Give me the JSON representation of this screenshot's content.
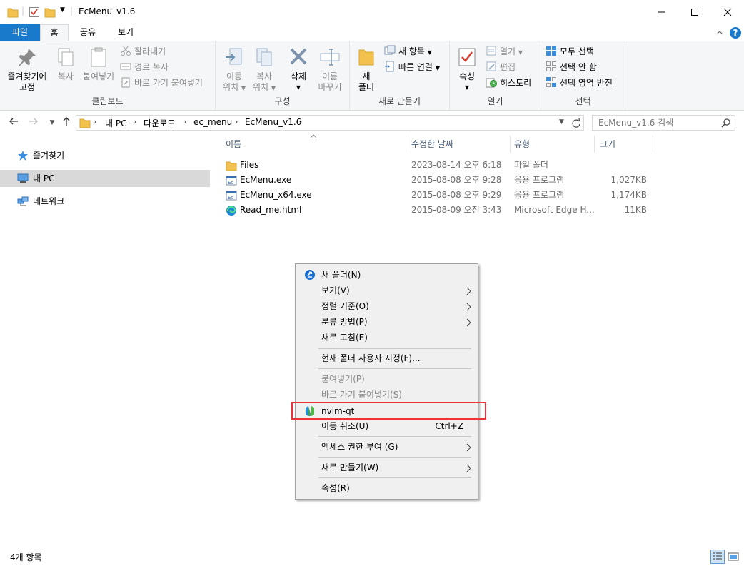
{
  "window": {
    "title": "EcMenu_v1.6",
    "minimize_label": "—",
    "maximize_label": "☐",
    "close_label": "✕"
  },
  "ribbon_tabs": {
    "file": "파일",
    "home": "홈",
    "share": "공유",
    "view": "보기"
  },
  "ribbon": {
    "clipboard": {
      "label": "클립보드",
      "pin": "즐겨찾기에\n고정",
      "pin_line1": "즐겨찾기에",
      "pin_line2": "고정",
      "copy": "복사",
      "paste": "붙여넣기",
      "cut": "잘라내기",
      "copy_path": "경로 복사",
      "paste_shortcut": "바로 가기 붙여넣기"
    },
    "organize": {
      "label": "구성",
      "move_line1": "이동",
      "move_line2": "위치",
      "copy_line1": "복사",
      "copy_line2": "위치",
      "delete": "삭제",
      "rename_line1": "이름",
      "rename_line2": "바꾸기"
    },
    "new": {
      "label": "새로 만들기",
      "folder_line1": "새",
      "folder_line2": "폴더",
      "new_item": "새 항목",
      "easy_access": "빠른 연결"
    },
    "open": {
      "label": "열기",
      "properties": "속성",
      "open": "열기",
      "edit": "편집",
      "history": "히스토리"
    },
    "select": {
      "label": "선택",
      "select_all": "모두 선택",
      "select_none": "선택 안 함",
      "invert": "선택 영역 반전"
    }
  },
  "address": {
    "crumbs": [
      "내 PC",
      "다운로드",
      "ec_menu",
      "EcMenu_v1.6"
    ],
    "search_placeholder": "EcMenu_v1.6 검색"
  },
  "navpane": {
    "items": [
      {
        "label": "즐겨찾기"
      },
      {
        "label": "내 PC"
      },
      {
        "label": "네트워크"
      }
    ]
  },
  "filelist": {
    "columns": [
      "이름",
      "수정한 날짜",
      "유형",
      "크기"
    ],
    "rows": [
      {
        "name": "Files",
        "date": "2023-08-14 오후 6:18",
        "type": "파일 폴더",
        "size": ""
      },
      {
        "name": "EcMenu.exe",
        "date": "2015-08-08 오후 9:28",
        "type": "응용 프로그램",
        "size": "1,027KB"
      },
      {
        "name": "EcMenu_x64.exe",
        "date": "2015-08-08 오후 9:29",
        "type": "응용 프로그램",
        "size": "1,174KB"
      },
      {
        "name": "Read_me.html",
        "date": "2015-08-09 오전 3:43",
        "type": "Microsoft Edge H...",
        "size": "11KB"
      }
    ]
  },
  "context_menu": {
    "new_folder": "새 폴더(N)",
    "view": "보기(V)",
    "sort_by": "정렬 기준(O)",
    "group_by": "분류 방법(P)",
    "refresh": "새로 고침(E)",
    "customize": "현재 폴더 사용자 지정(F)...",
    "paste": "붙여넣기(P)",
    "paste_shortcut": "바로 가기 붙여넣기(S)",
    "nvim_qt": "nvim-qt",
    "undo_move": "이동 취소(U)",
    "undo_shortcut": "Ctrl+Z",
    "give_access": "액세스 권한 부여 (G)",
    "new": "새로 만들기(W)",
    "properties": "속성(R)"
  },
  "status": {
    "count": "4개 항목"
  },
  "colors": {
    "accent": "#1979ca",
    "highlight_box": "#e8343a",
    "folder": "#f2c14e"
  }
}
